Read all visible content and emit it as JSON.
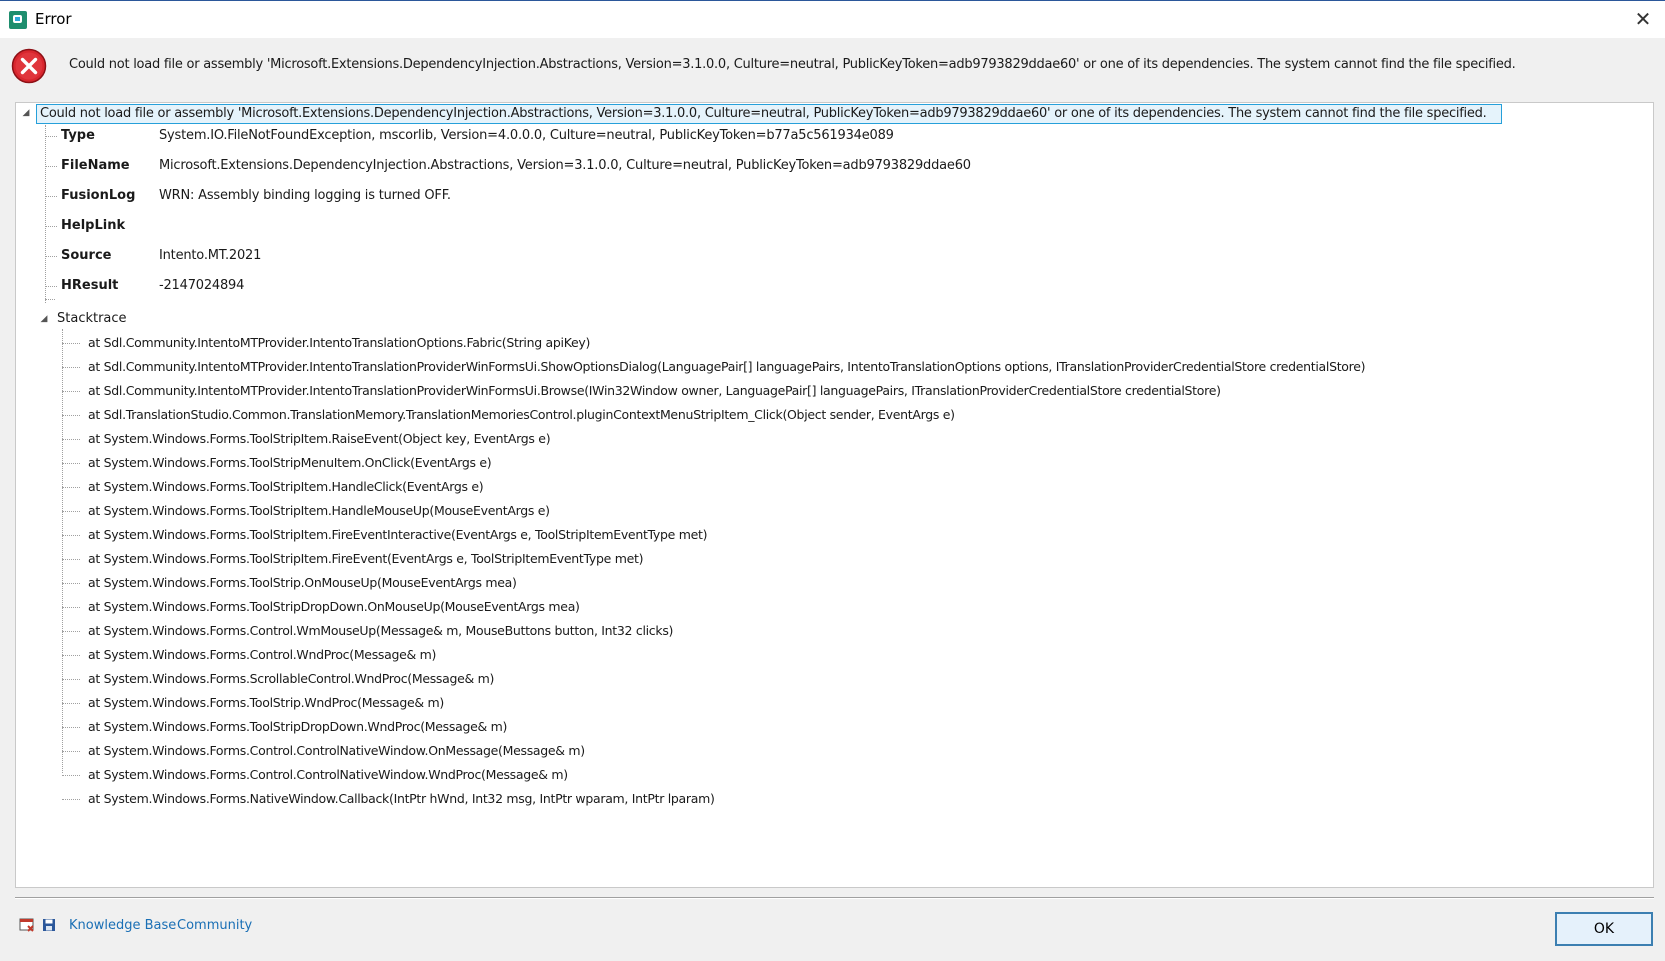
{
  "window": {
    "title": "Error",
    "close_glyph": "✕",
    "accent_color": "#2b579a"
  },
  "icons": {
    "app": "app-icon",
    "error": "error-icon",
    "close": "close-icon",
    "report": "report-icon",
    "save": "save-icon"
  },
  "message": "Could not load file or assembly 'Microsoft.Extensions.DependencyInjection.Abstractions, Version=3.1.0.0, Culture=neutral, PublicKeyToken=adb9793829ddae60' or one of its dependencies. The system cannot find the file specified.",
  "tree": {
    "root_label": "Could not load file or assembly 'Microsoft.Extensions.DependencyInjection.Abstractions, Version=3.1.0.0, Culture=neutral, PublicKeyToken=adb9793829ddae60' or one of its dependencies. The system cannot find the file specified.",
    "properties": [
      {
        "name": "Type",
        "value": "System.IO.FileNotFoundException, mscorlib, Version=4.0.0.0, Culture=neutral, PublicKeyToken=b77a5c561934e089"
      },
      {
        "name": "FileName",
        "value": "Microsoft.Extensions.DependencyInjection.Abstractions, Version=3.1.0.0, Culture=neutral, PublicKeyToken=adb9793829ddae60"
      },
      {
        "name": "FusionLog",
        "value": "WRN: Assembly binding logging is turned OFF."
      },
      {
        "name": "HelpLink",
        "value": ""
      },
      {
        "name": "Source",
        "value": "Intento.MT.2021"
      },
      {
        "name": "HResult",
        "value": "-2147024894"
      }
    ],
    "stacktrace_label": "Stacktrace",
    "stacktrace": [
      "at Sdl.Community.IntentoMTProvider.IntentoTranslationOptions.Fabric(String apiKey)",
      "at Sdl.Community.IntentoMTProvider.IntentoTranslationProviderWinFormsUi.ShowOptionsDialog(LanguagePair[] languagePairs, IntentoTranslationOptions options, ITranslationProviderCredentialStore credentialStore)",
      "at Sdl.Community.IntentoMTProvider.IntentoTranslationProviderWinFormsUi.Browse(IWin32Window owner, LanguagePair[] languagePairs, ITranslationProviderCredentialStore credentialStore)",
      "at Sdl.TranslationStudio.Common.TranslationMemory.TranslationMemoriesControl.pluginContextMenuStripItem_Click(Object sender, EventArgs e)",
      "at System.Windows.Forms.ToolStripItem.RaiseEvent(Object key, EventArgs e)",
      "at System.Windows.Forms.ToolStripMenuItem.OnClick(EventArgs e)",
      "at System.Windows.Forms.ToolStripItem.HandleClick(EventArgs e)",
      "at System.Windows.Forms.ToolStripItem.HandleMouseUp(MouseEventArgs e)",
      "at System.Windows.Forms.ToolStripItem.FireEventInteractive(EventArgs e, ToolStripItemEventType met)",
      "at System.Windows.Forms.ToolStripItem.FireEvent(EventArgs e, ToolStripItemEventType met)",
      "at System.Windows.Forms.ToolStrip.OnMouseUp(MouseEventArgs mea)",
      "at System.Windows.Forms.ToolStripDropDown.OnMouseUp(MouseEventArgs mea)",
      "at System.Windows.Forms.Control.WmMouseUp(Message& m, MouseButtons button, Int32 clicks)",
      "at System.Windows.Forms.Control.WndProc(Message& m)",
      "at System.Windows.Forms.ScrollableControl.WndProc(Message& m)",
      "at System.Windows.Forms.ToolStrip.WndProc(Message& m)",
      "at System.Windows.Forms.ToolStripDropDown.WndProc(Message& m)",
      "at System.Windows.Forms.Control.ControlNativeWindow.OnMessage(Message& m)",
      "at System.Windows.Forms.Control.ControlNativeWindow.WndProc(Message& m)",
      "at System.Windows.Forms.NativeWindow.Callback(IntPtr hWnd, Int32 msg, IntPtr wparam, IntPtr lparam)"
    ]
  },
  "footer": {
    "links": [
      "Knowledge Base",
      "Community"
    ],
    "ok_label": "OK",
    "link_color": "#1a6fb5"
  }
}
